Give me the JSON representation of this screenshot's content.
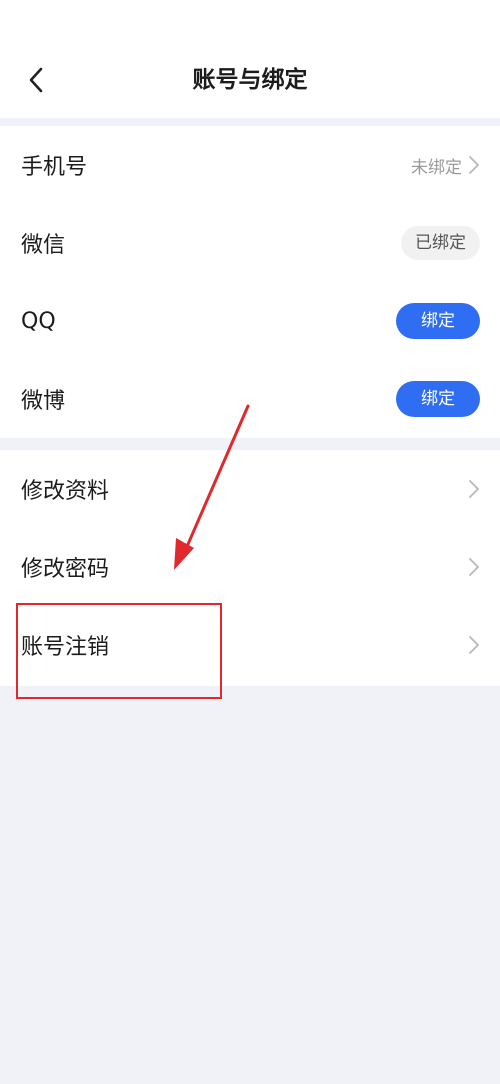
{
  "header": {
    "title": "账号与绑定"
  },
  "bindings": [
    {
      "label": "手机号",
      "status": "未绑定"
    },
    {
      "label": "微信",
      "status": "已绑定"
    },
    {
      "label": "QQ",
      "action": "绑定"
    },
    {
      "label": "微博",
      "action": "绑定"
    }
  ],
  "settings": [
    {
      "label": "修改资料"
    },
    {
      "label": "修改密码"
    },
    {
      "label": "账号注销"
    }
  ],
  "colors": {
    "accent": "#2f6ef2",
    "annotation": "#e0282d",
    "background": "#f1f2f7"
  },
  "icons": {
    "back": "chevron-left-icon",
    "chevron": "chevron-right-icon"
  }
}
